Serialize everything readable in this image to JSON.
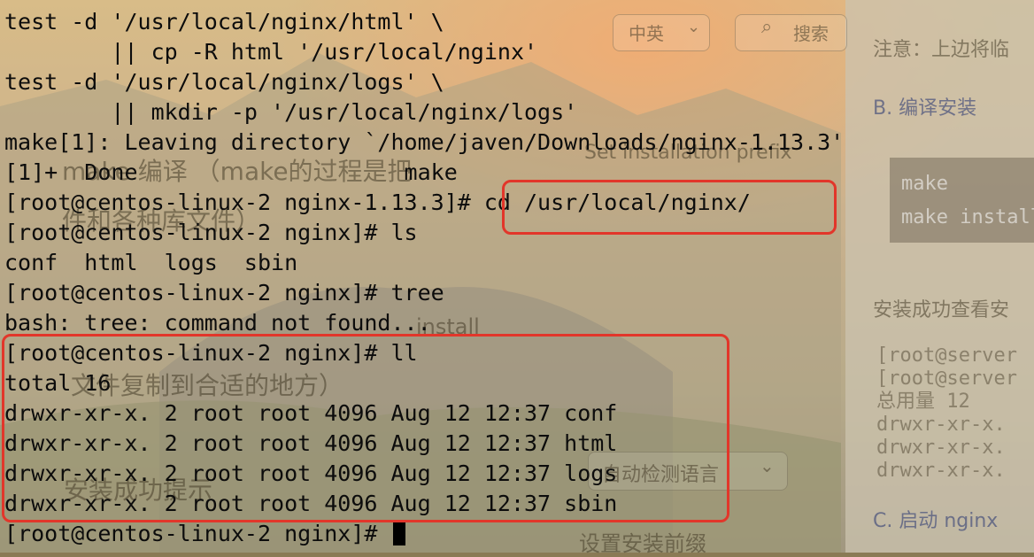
{
  "terminal": {
    "lines": [
      "test -d '/usr/local/nginx/html' \\",
      "        || cp -R html '/usr/local/nginx'",
      "test -d '/usr/local/nginx/logs' \\",
      "        || mkdir -p '/usr/local/nginx/logs'",
      "make[1]: Leaving directory `/home/javen/Downloads/nginx-1.13.3'",
      "[1]+  Done                    make",
      "[root@centos-linux-2 nginx-1.13.3]# cd /usr/local/nginx/",
      "[root@centos-linux-2 nginx]# ls",
      "conf  html  logs  sbin",
      "[root@centos-linux-2 nginx]# tree",
      "bash: tree: command not found...",
      "[root@centos-linux-2 nginx]# ll",
      "total 16",
      "drwxr-xr-x. 2 root root 4096 Aug 12 12:37 conf",
      "drwxr-xr-x. 2 root root 4096 Aug 12 12:37 html",
      "drwxr-xr-x. 2 root root 4096 Aug 12 12:37 logs",
      "drwxr-xr-x. 2 root root 4096 Aug 12 12:37 sbin",
      "[root@centos-linux-2 nginx]# "
    ],
    "highlight_color": "#e2362a"
  },
  "background_ui": {
    "translate_lang": "中英",
    "search_hint": "搜索",
    "make_compile": "make 编译 （make的过程是把",
    "make_compile_2": "件和各种库文件）",
    "copy_files": "文件复制到合适的地方）",
    "install_success_hint": "安装成功提示",
    "detect_language": "自动检测语言",
    "set_prefix": "设置安装前缀",
    "set_install_prefix": "Set installation prefix",
    "install_label": "install",
    "note": "注意：上边将临",
    "compile_install": "B. 编译安装",
    "code_make": "make",
    "code_make_install": "make install",
    "install_check": "安装成功查看安",
    "bg_code_1": "[root@server",
    "bg_code_2": "[root@server",
    "bg_code_3": "总用量 12",
    "bg_code_4": "drwxr-xr-x.",
    "bg_code_5": "drwxr-xr-x.",
    "bg_code_6": "drwxr-xr-x.",
    "start_nginx": "C. 启动 nginx"
  }
}
